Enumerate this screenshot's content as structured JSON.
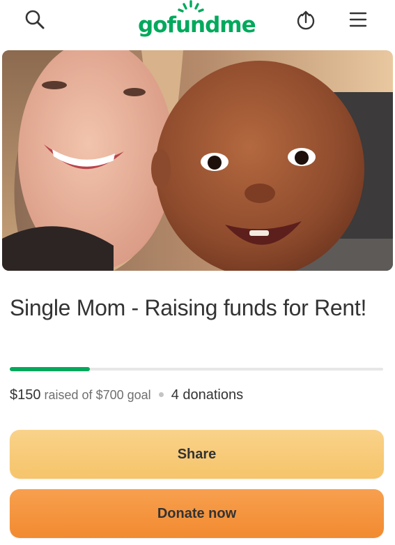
{
  "header": {
    "logo_text": "gofundme",
    "brand_color": "#02a95c",
    "icons": [
      "search-icon",
      "share-upload-icon",
      "hamburger-menu-icon"
    ]
  },
  "campaign": {
    "title": "Single Mom - Raising funds for Rent!",
    "raised": "$150",
    "raised_of_label": "raised of",
    "goal": "$700",
    "goal_label": "goal",
    "donations": "4 donations",
    "progress_fraction": 0.214
  },
  "actions": {
    "share_label": "Share",
    "donate_label": "Donate now",
    "share_color": "#f7c86e",
    "donate_color": "#f5923a"
  }
}
